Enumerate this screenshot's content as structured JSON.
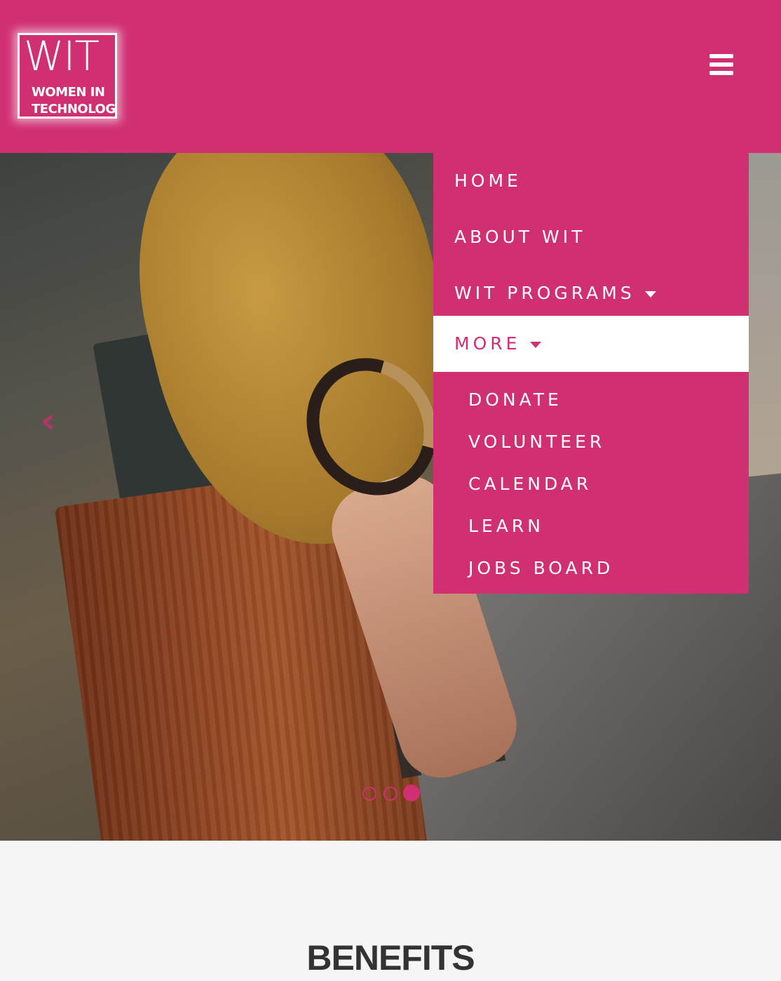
{
  "header": {
    "logo_main": "WIT",
    "logo_line1": "WOMEN IN",
    "logo_line2": "TECHNOLOGY",
    "menu_icon": "hamburger-icon"
  },
  "carousel": {
    "prev_icon": "chevron-left-icon",
    "active_slide": 3,
    "slide_count": 3
  },
  "nav": {
    "items": [
      {
        "label": "HOME"
      },
      {
        "label": "ABOUT WIT"
      },
      {
        "label": "WIT PROGRAMS"
      },
      {
        "label": "MORE"
      }
    ],
    "more_submenu": [
      {
        "label": "DONATE"
      },
      {
        "label": "VOLUNTEER"
      },
      {
        "label": "CALENDAR"
      },
      {
        "label": "LEARN"
      },
      {
        "label": "JOBS BOARD"
      }
    ]
  },
  "benefits": {
    "title": "BENEFITS"
  },
  "colors": {
    "brand": "#d02f72",
    "background": "#f5f5f5",
    "heading": "#333333"
  }
}
